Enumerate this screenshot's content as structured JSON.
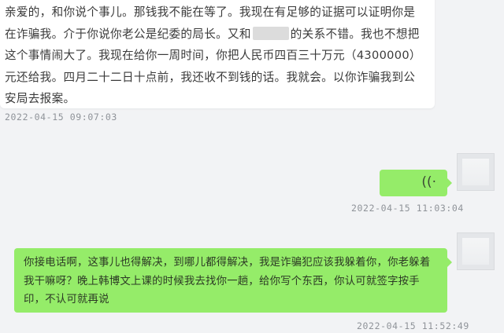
{
  "messages": {
    "first": {
      "part1": "亲爱的，和你说个事儿。那钱我不能在等了。我现在有足够的证据可以证明你是在诈骗我。介于你说你老公是纪委的局长。又和",
      "part2": "的关系不错。我也不想把这个事情闹大了。我现在给你一周时间，你把人民币四百三十万元（4300000）元还给我。四月二十二日十点前，我还收不到钱的话。我就会。以你诈骗我到公安局去报案。",
      "timestamp": "2022-04-15 09:07:03"
    },
    "voice": {
      "icon": "voice-wave-icon",
      "timestamp": "2022-04-15 11:03:04"
    },
    "third": {
      "text": "你接电话啊，这事儿也得解决，到哪儿都得解决，我是诈骗犯应该我躲着你，你老躲着我干嘛呀？晚上韩博文上课的时候我去找你一趟，给你写个东西，你认可就签字按手印，不认可就再说",
      "timestamp": "2022-04-15 11:52:49"
    }
  },
  "colors": {
    "incoming_bubble": "#ffffff",
    "outgoing_bubble": "#95ec69",
    "background": "#f2f3f5",
    "timestamp": "#8f9399"
  }
}
